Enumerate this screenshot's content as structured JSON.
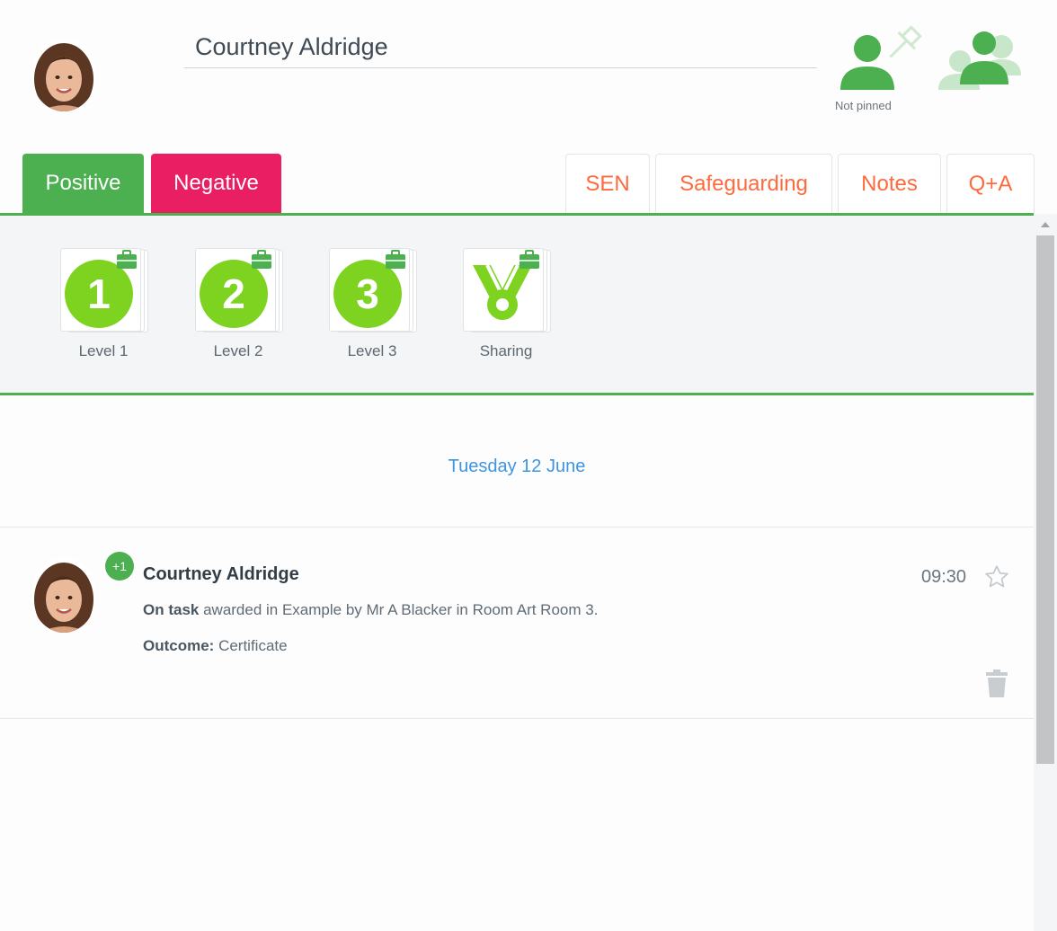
{
  "student": {
    "name": "Courtney Aldridge",
    "avatar_icon": "student-photo"
  },
  "pin": {
    "label": "Not pinned",
    "icon": "person-pin-icon"
  },
  "group": {
    "icon": "group-icon"
  },
  "tabs": {
    "primary": [
      {
        "label": "Positive",
        "color": "#4caf50"
      },
      {
        "label": "Negative",
        "color": "#e91e63"
      }
    ],
    "secondary": [
      {
        "label": "SEN"
      },
      {
        "label": "Safeguarding"
      },
      {
        "label": "Notes"
      },
      {
        "label": "Q+A"
      }
    ],
    "accent_color": "#ff6a3d"
  },
  "awards": [
    {
      "label": "Level 1",
      "glyph": "1",
      "icon": "level-1-badge-icon"
    },
    {
      "label": "Level 2",
      "glyph": "2",
      "icon": "level-2-badge-icon"
    },
    {
      "label": "Level 3",
      "glyph": "3",
      "icon": "level-3-badge-icon"
    },
    {
      "label": "Sharing",
      "glyph": "",
      "icon": "medal-icon"
    }
  ],
  "timeline": {
    "date": "Tuesday 12 June",
    "entries": [
      {
        "points": "+1",
        "name": "Courtney Aldridge",
        "behaviour": "On task",
        "description": " awarded in Example by Mr A Blacker in Room Art Room 3.",
        "outcome_label": "Outcome:",
        "outcome_value": " Certificate",
        "time": "09:30"
      }
    ]
  }
}
